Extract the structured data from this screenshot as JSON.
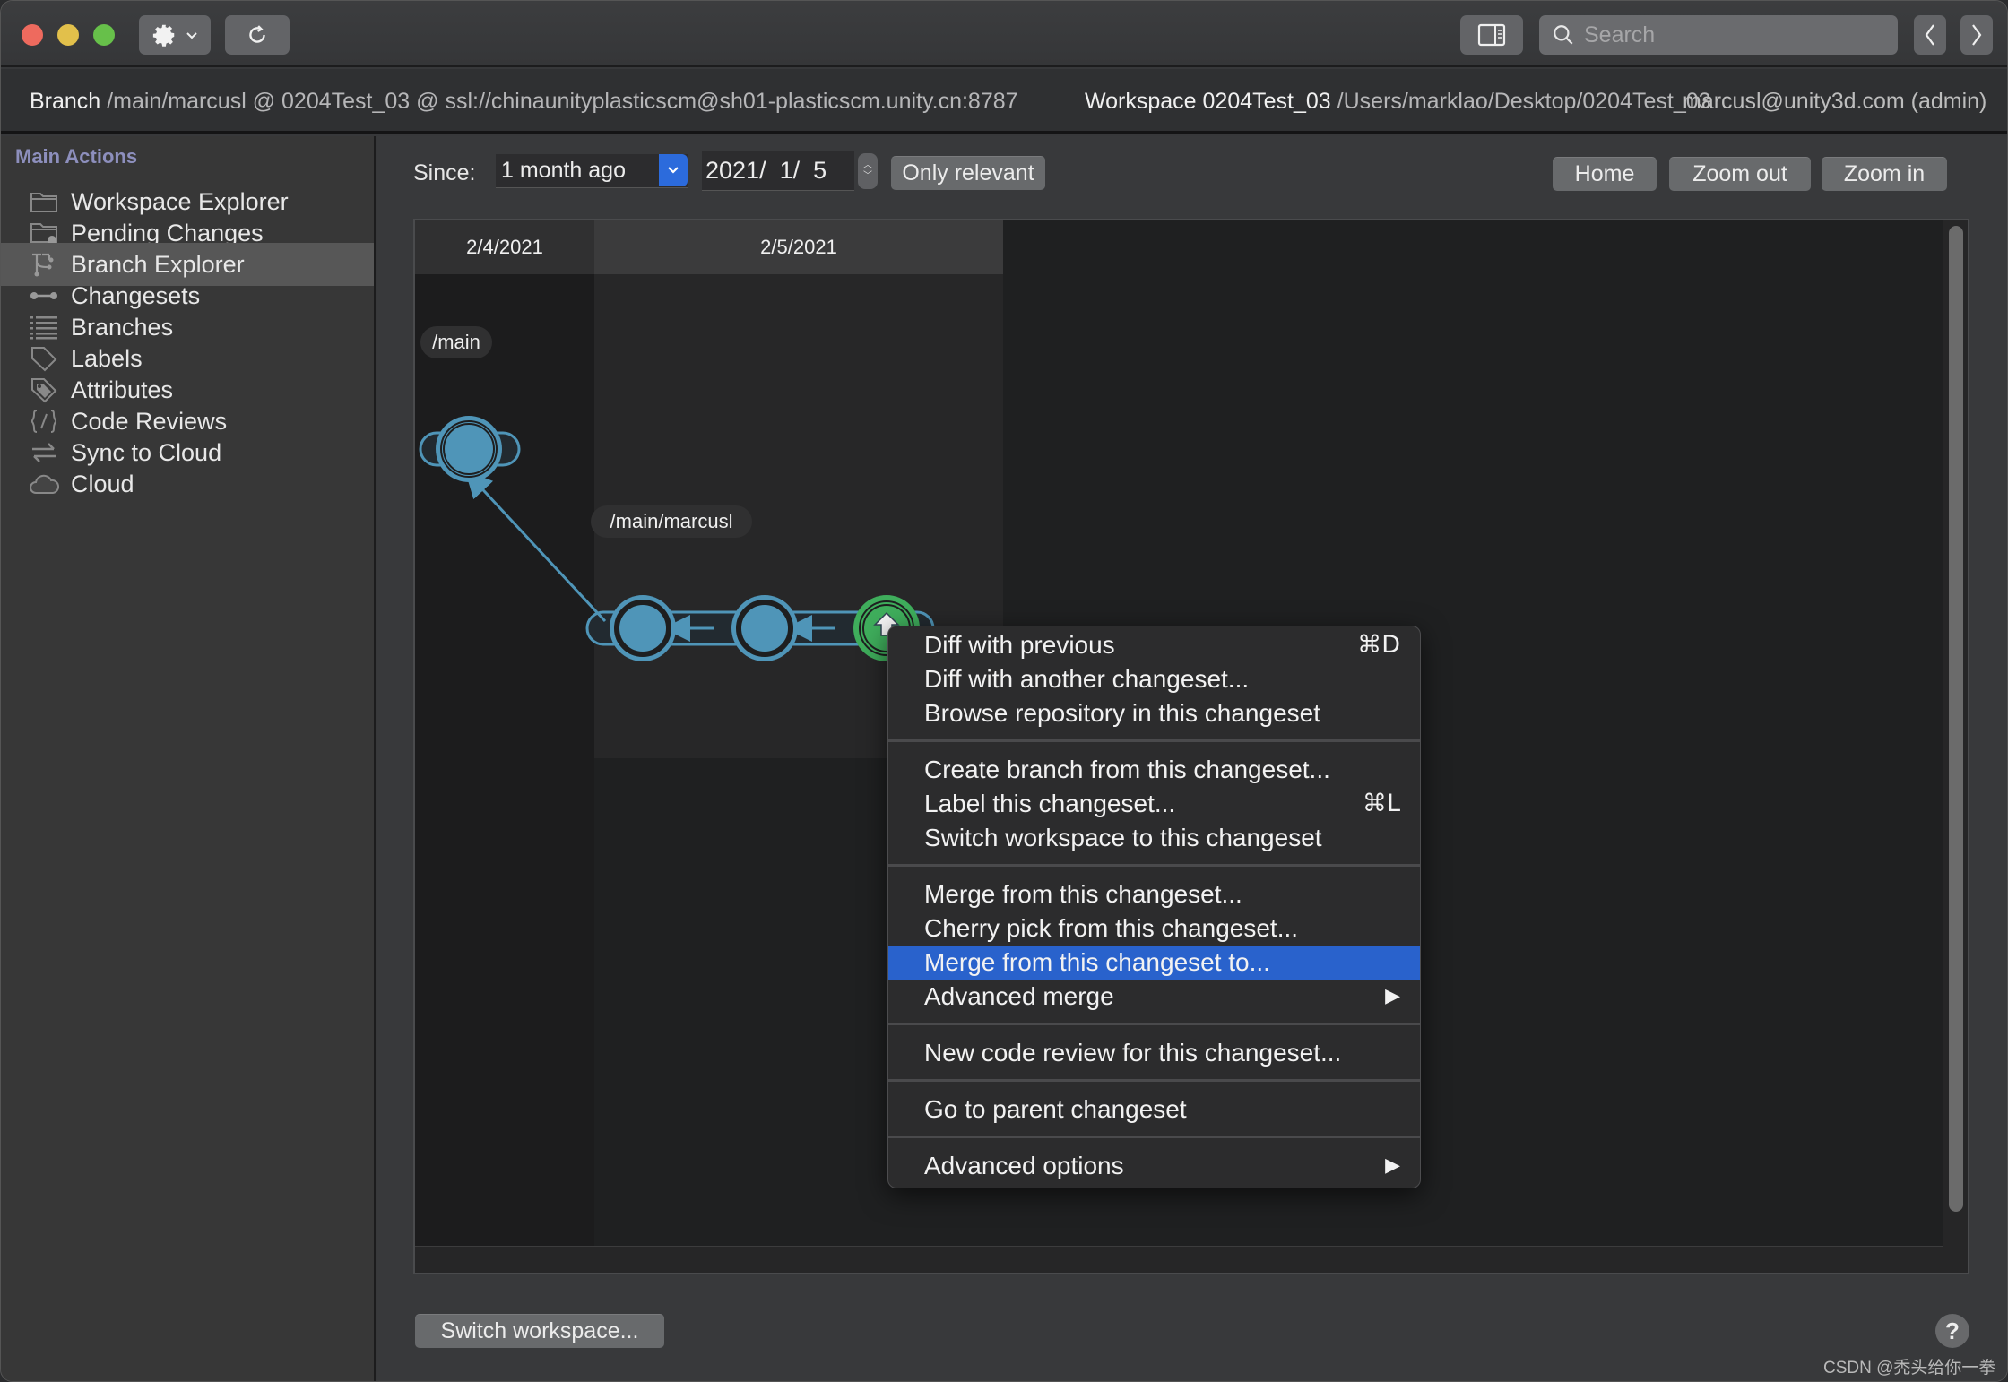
{
  "titlebar": {
    "search_placeholder": "Search",
    "icons": {
      "settings": "gear-icon",
      "refresh": "refresh-icon",
      "panel": "sidebar-toggle-icon",
      "back": "chevron-left-icon",
      "forward": "chevron-right-icon"
    }
  },
  "infobar": {
    "branch_label": "Branch",
    "branch_value": "/main/marcusl @ 0204Test_03 @ ssl://chinaunityplasticscm@sh01-plasticscm.unity.cn:8787",
    "workspace_label": "Workspace 0204Test_03",
    "workspace_path": "/Users/marklao/Desktop/0204Test_03",
    "user": "marcusl@unity3d.com (admin)"
  },
  "sidebar": {
    "header": "Main Actions",
    "selected": "Branch Explorer",
    "items": [
      {
        "label": "Workspace Explorer",
        "icon": "folder-icon"
      },
      {
        "label": "Pending Changes",
        "icon": "folder-pending-icon"
      },
      {
        "label": "Branch Explorer",
        "icon": "branch-explorer-icon"
      },
      {
        "label": "Changesets",
        "icon": "changesets-icon"
      },
      {
        "label": "Branches",
        "icon": "list-icon"
      },
      {
        "label": "Labels",
        "icon": "tag-icon"
      },
      {
        "label": "Attributes",
        "icon": "attribute-tag-icon"
      },
      {
        "label": "Code Reviews",
        "icon": "code-review-icon"
      },
      {
        "label": "Sync to Cloud",
        "icon": "sync-icon"
      },
      {
        "label": "Cloud",
        "icon": "cloud-icon"
      }
    ]
  },
  "toolbar": {
    "since_label": "Since:",
    "since_value": "1 month ago",
    "date_value": "2021/  1/  5",
    "only_relevant": "Only relevant",
    "home": "Home",
    "zoom_out": "Zoom out",
    "zoom_in": "Zoom in"
  },
  "graph": {
    "date_columns": [
      "2/4/2021",
      "2/5/2021"
    ],
    "branches": [
      {
        "name": "/main",
        "changesets": 1
      },
      {
        "name": "/main/marcusl",
        "changesets": 3,
        "current_changeset_is_last": true
      }
    ],
    "colors": {
      "changeset": "#4f95b8",
      "current_changeset": "#3fae5c"
    }
  },
  "context_menu": {
    "groups": [
      [
        {
          "label": "Diff with previous",
          "shortcut": "⌘D"
        },
        {
          "label": "Diff with another changeset..."
        },
        {
          "label": "Browse repository in this changeset"
        }
      ],
      [
        {
          "label": "Create branch from this changeset..."
        },
        {
          "label": "Label this changeset...",
          "shortcut": "⌘L"
        },
        {
          "label": "Switch workspace to this changeset"
        }
      ],
      [
        {
          "label": "Merge from this changeset..."
        },
        {
          "label": "Cherry pick from this changeset..."
        },
        {
          "label": "Merge from this changeset to...",
          "highlighted": true
        },
        {
          "label": "Advanced merge",
          "submenu": "▶"
        }
      ],
      [
        {
          "label": "New code review for this changeset..."
        }
      ],
      [
        {
          "label": "Go to parent changeset"
        }
      ],
      [
        {
          "label": "Advanced options",
          "submenu": "▶"
        }
      ]
    ],
    "highlight_color": "#2962cc"
  },
  "footer": {
    "switch_workspace": "Switch workspace...",
    "help": "?",
    "watermark": "CSDN @秃头给你一拳"
  }
}
